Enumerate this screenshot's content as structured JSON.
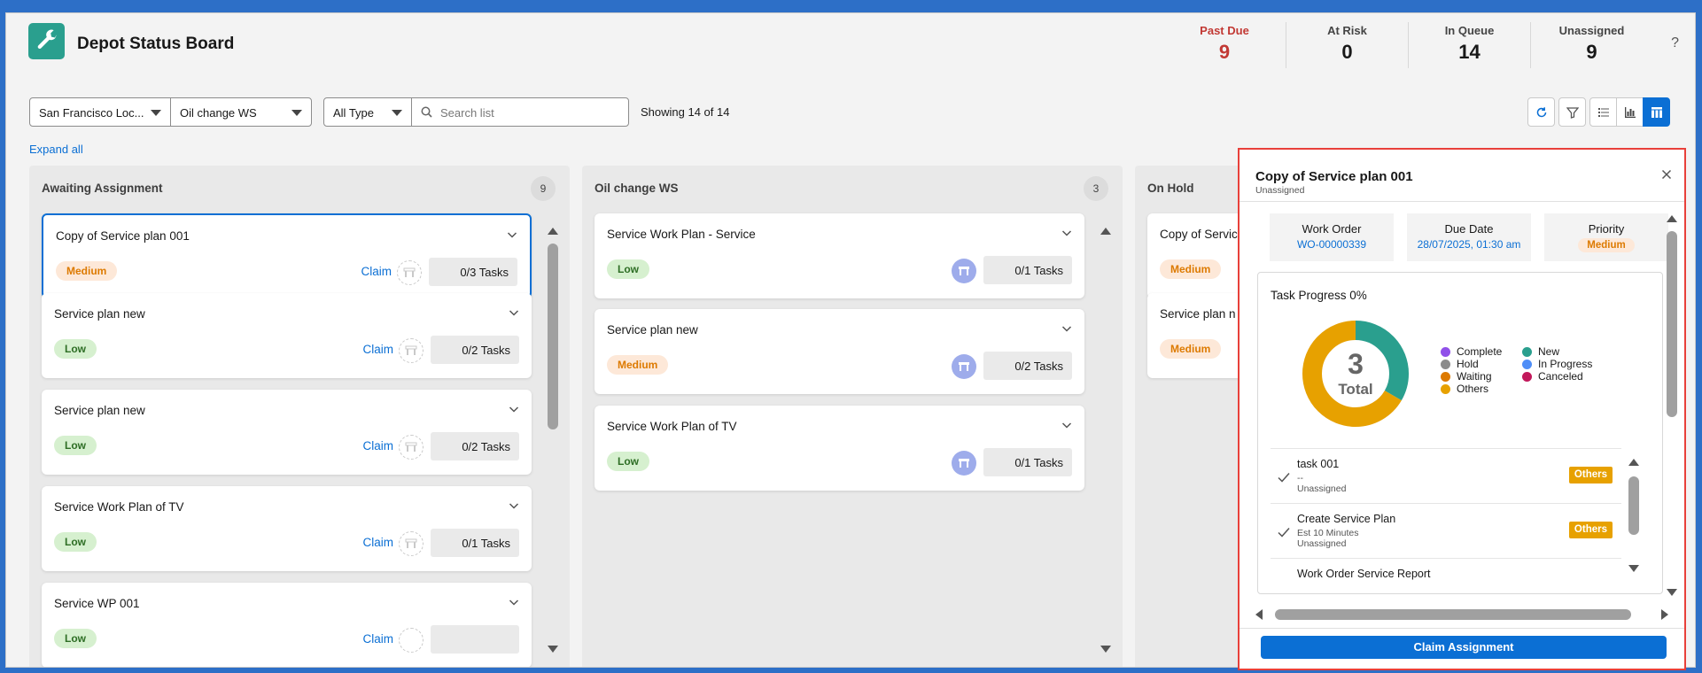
{
  "app": {
    "title": "Depot Status Board"
  },
  "kpis": [
    {
      "label": "Past Due",
      "value": "9",
      "color": "#c23934"
    },
    {
      "label": "At Risk",
      "value": "0"
    },
    {
      "label": "In Queue",
      "value": "14"
    },
    {
      "label": "Unassigned",
      "value": "9"
    }
  ],
  "toolbar": {
    "location": "San Francisco Loc...",
    "workstation": "Oil change WS",
    "type": "All Type",
    "search_placeholder": "Search list",
    "showing": "Showing 14 of 14",
    "buttons": [
      "refresh-icon",
      "filter-icon",
      "list-view-icon",
      "chart-view-icon",
      "board-view-icon"
    ]
  },
  "expand_all": "Expand all",
  "columns": [
    {
      "title": "Awaiting Assignment",
      "count": "9",
      "cards": [
        {
          "title": "Copy of Service plan 001",
          "priority": "Medium",
          "claim": "Claim",
          "tasks": "0/3 Tasks",
          "selected": true
        },
        {
          "title": "Service plan new",
          "priority": "Low",
          "claim": "Claim",
          "tasks": "0/2 Tasks"
        },
        {
          "title": "Service plan new",
          "priority": "Low",
          "claim": "Claim",
          "tasks": "0/2 Tasks"
        },
        {
          "title": "Service Work Plan of TV",
          "priority": "Low",
          "claim": "Claim",
          "tasks": "0/1 Tasks"
        },
        {
          "title": "Service WP 001",
          "priority": "Low",
          "claim": "Claim",
          "tasks": ""
        }
      ]
    },
    {
      "title": "Oil change WS",
      "count": "3",
      "cards": [
        {
          "title": "Service Work Plan - Service",
          "priority": "Low",
          "tasks": "0/1 Tasks"
        },
        {
          "title": "Service plan new",
          "priority": "Medium",
          "tasks": "0/2 Tasks"
        },
        {
          "title": "Service Work Plan of TV",
          "priority": "Low",
          "tasks": "0/1 Tasks"
        }
      ]
    },
    {
      "title": "On Hold",
      "cards": [
        {
          "title": "Copy of Servic",
          "priority": "Medium"
        },
        {
          "title": "Service plan n",
          "priority": "Medium"
        }
      ]
    }
  ],
  "detail": {
    "title": "Copy of Service plan 001",
    "subtitle": "Unassigned",
    "work_order_label": "Work Order",
    "work_order_value": "WO-00000339",
    "due_date_label": "Due Date",
    "due_date_value": "28/07/2025, 01:30 am",
    "priority_label": "Priority",
    "priority_value": "Medium",
    "progress_title": "Task Progress 0%",
    "donut_total": "3",
    "donut_total_label": "Total",
    "donut_segments": [
      {
        "status": "New",
        "count": 1,
        "color": "#2a9f8e"
      },
      {
        "status": "Others",
        "count": 2,
        "color": "#e7a100"
      }
    ],
    "legend": [
      {
        "label": "Complete",
        "color": "#9050e9"
      },
      {
        "label": "New",
        "color": "#2a9f8e"
      },
      {
        "label": "Hold",
        "color": "#8c8c8c"
      },
      {
        "label": "In Progress",
        "color": "#4f8ef7"
      },
      {
        "label": "Waiting",
        "color": "#dd7a01"
      },
      {
        "label": "Canceled",
        "color": "#c2185b"
      },
      {
        "label": "Others",
        "color": "#e7a100"
      }
    ],
    "tasks": [
      {
        "name": "task 001",
        "line2": "--",
        "line3": "Unassigned",
        "status": "Others"
      },
      {
        "name": "Create Service Plan",
        "line2": "Est 10 Minutes",
        "line3": "Unassigned",
        "status": "Others"
      },
      {
        "name": "Work Order Service Report",
        "line2": "",
        "line3": "",
        "status": ""
      }
    ],
    "claim_button": "Claim Assignment"
  }
}
